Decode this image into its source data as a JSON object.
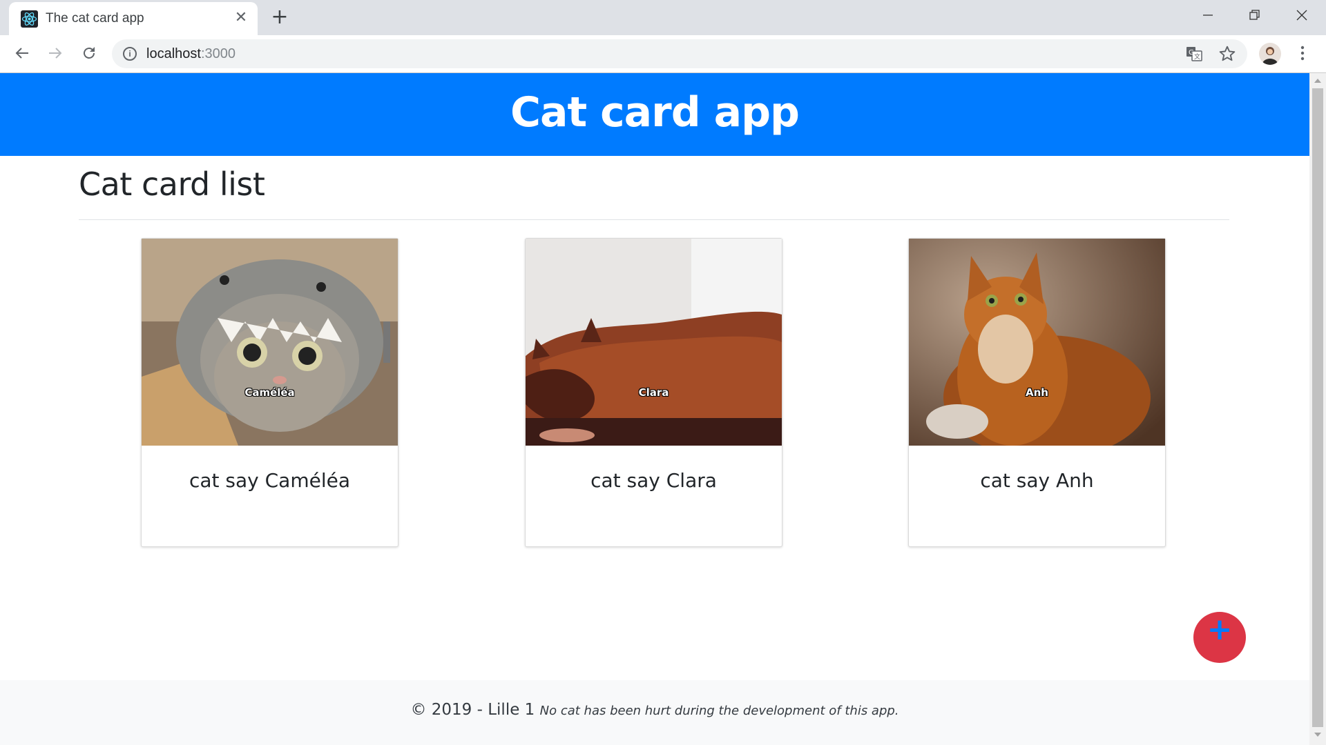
{
  "browser": {
    "tab_title": "The cat card app",
    "tab_close": "✕",
    "new_tab": "+",
    "url_host": "localhost",
    "url_port": ":3000",
    "info_glyph": "i"
  },
  "app": {
    "title": "Cat card app",
    "list_heading": "Cat card list",
    "accent_color": "#007bff",
    "fab_color": "#dc3545",
    "fab_label": "+"
  },
  "cards": [
    {
      "meme_text": "Caméléa",
      "caption": "cat say Caméléa"
    },
    {
      "meme_text": "Clara",
      "caption": "cat say Clara"
    },
    {
      "meme_text": "Anh",
      "caption": "cat say Anh"
    }
  ],
  "footer": {
    "copyright": "© 2019 - Lille 1",
    "note": "No cat has been hurt during the development of this app."
  }
}
